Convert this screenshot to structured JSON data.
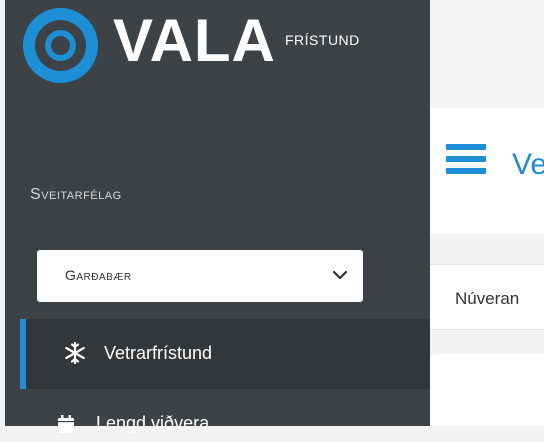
{
  "brand": {
    "name": "VALA",
    "subtitle": "FRÍSTUND",
    "accent": "#1c8fd6"
  },
  "sidebar": {
    "section_label": "Sveitarfélag",
    "municipality_select": {
      "value": "Garðabær"
    },
    "items": [
      {
        "label": "Vetrarfrístund",
        "icon": "snowflake-icon",
        "active": true
      },
      {
        "label": "Lengd viðvera",
        "icon": "calendar-icon",
        "active": false
      }
    ]
  },
  "header": {
    "page_title": "Ve"
  },
  "tabs": {
    "current_label": "Núveran"
  }
}
